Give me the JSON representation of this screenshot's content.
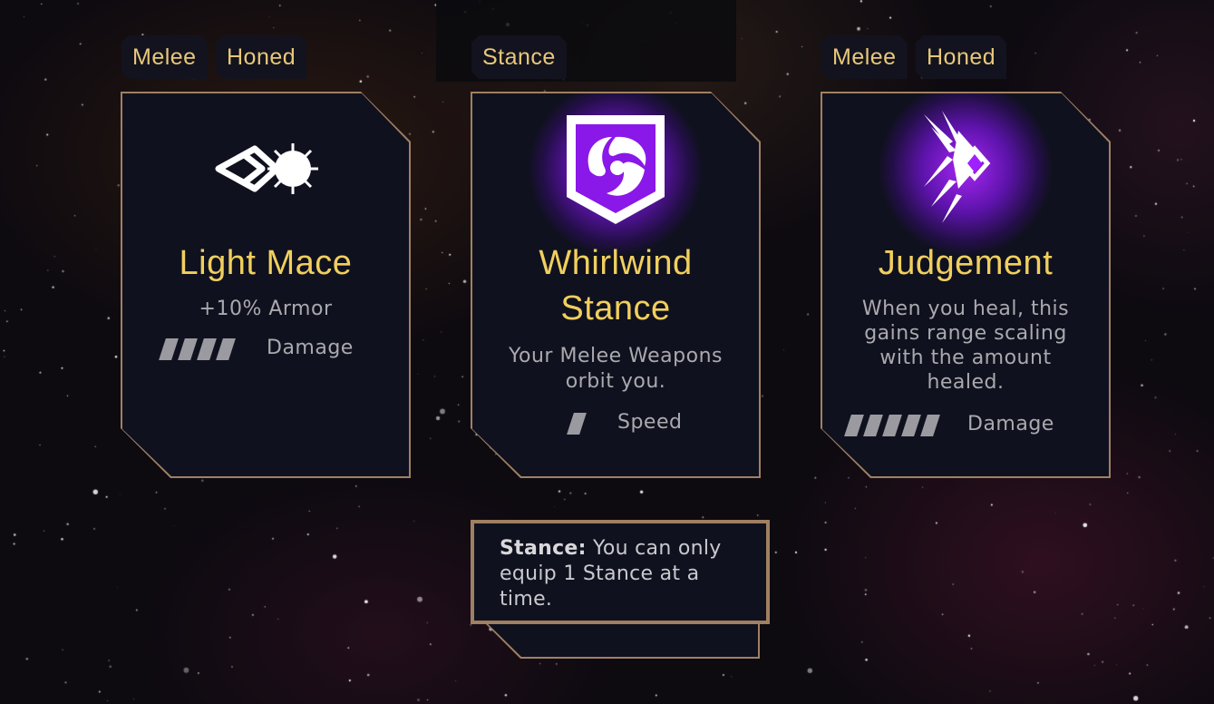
{
  "cards": [
    {
      "tags": [
        "Melee",
        "Honed"
      ],
      "icon": "mace-icon",
      "title_lines": [
        "Light Mace"
      ],
      "description": "+10% Armor",
      "stat": {
        "pips": 4,
        "label": "Damage"
      }
    },
    {
      "tags": [
        "Stance"
      ],
      "icon": "whirlwind-shield-icon",
      "title_lines": [
        "Whirlwind",
        "Stance"
      ],
      "description_lines": [
        "Your Melee Weapons",
        "orbit you."
      ],
      "stat": {
        "pips": 1,
        "label": "Speed"
      }
    },
    {
      "tags": [
        "Melee",
        "Honed"
      ],
      "icon": "judgement-wings-icon",
      "title_lines": [
        "Judgement"
      ],
      "description_lines": [
        "When you heal, this",
        "gains range scaling",
        "with the amount",
        "healed."
      ],
      "stat": {
        "pips": 5,
        "label": "Damage"
      }
    }
  ],
  "tooltip": {
    "term": "Stance:",
    "text": " You can only equip 1 Stance at a time."
  },
  "colors": {
    "title": "#f1cf5e",
    "border": "#a08062",
    "panel": "#10111e",
    "glow": "#b028ff"
  }
}
